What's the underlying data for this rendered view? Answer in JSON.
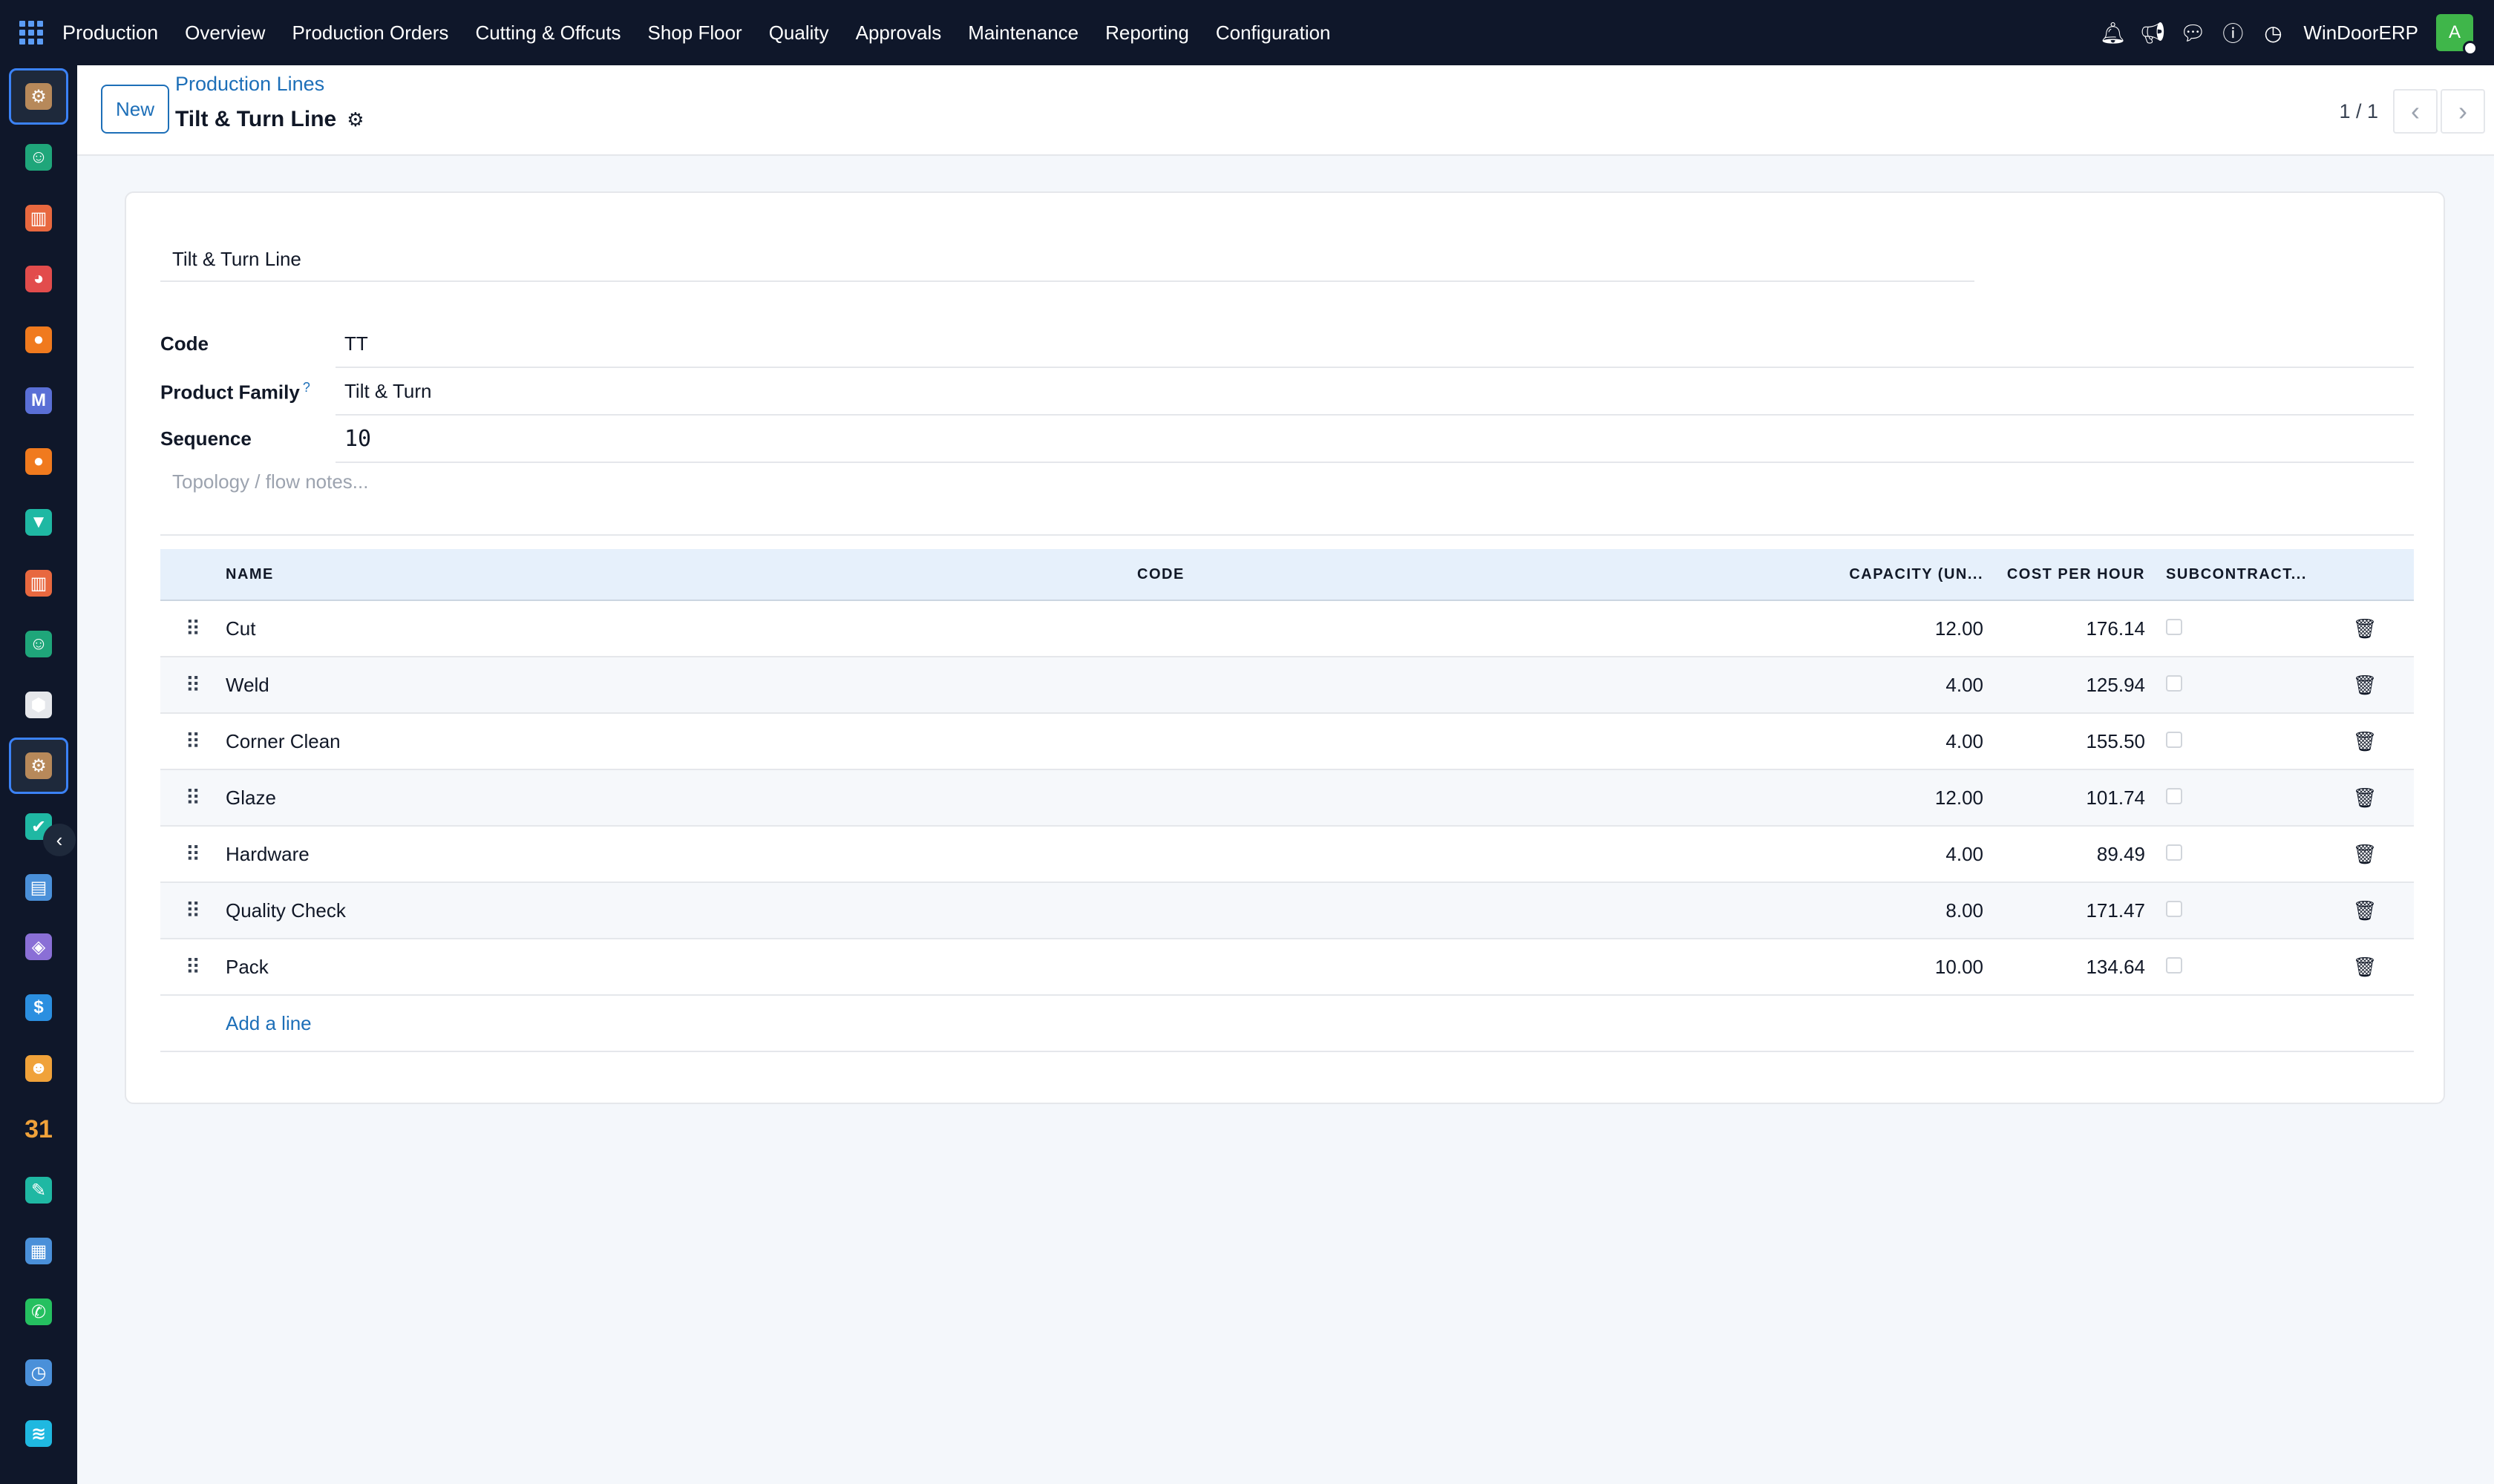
{
  "topbar": {
    "brand": "Production",
    "menu": [
      "Overview",
      "Production Orders",
      "Cutting & Offcuts",
      "Shop Floor",
      "Quality",
      "Approvals",
      "Maintenance",
      "Reporting",
      "Configuration"
    ],
    "company": "WinDoorERP",
    "avatar_letter": "A"
  },
  "control": {
    "new_label": "New",
    "breadcrumb": "Production Lines",
    "record_title": "Tilt & Turn Line",
    "pager": "1 / 1"
  },
  "form": {
    "name": "Tilt & Turn Line",
    "code_label": "Code",
    "code_value": "TT",
    "family_label": "Product Family",
    "family_help": "?",
    "family_value": "Tilt & Turn",
    "sequence_label": "Sequence",
    "sequence_value": "10",
    "notes_placeholder": "Topology / flow notes..."
  },
  "table": {
    "headers": {
      "name": "NAME",
      "code": "CODE",
      "capacity": "CAPACITY (UN...",
      "cost": "COST PER HOUR",
      "subcontract": "SUBCONTRACT..."
    },
    "rows": [
      {
        "name": "Cut",
        "code": "",
        "capacity": "12.00",
        "cost": "176.14"
      },
      {
        "name": "Weld",
        "code": "",
        "capacity": "4.00",
        "cost": "125.94"
      },
      {
        "name": "Corner Clean",
        "code": "",
        "capacity": "4.00",
        "cost": "155.50"
      },
      {
        "name": "Glaze",
        "code": "",
        "capacity": "12.00",
        "cost": "101.74"
      },
      {
        "name": "Hardware",
        "code": "",
        "capacity": "4.00",
        "cost": "89.49"
      },
      {
        "name": "Quality Check",
        "code": "",
        "capacity": "8.00",
        "cost": "171.47"
      },
      {
        "name": "Pack",
        "code": "",
        "capacity": "10.00",
        "cost": "134.64"
      }
    ],
    "add_line": "Add a line"
  },
  "sidebar_apps": [
    {
      "icon": "production-app-icon",
      "color": "#b7895a",
      "glyph": "⚙"
    },
    {
      "icon": "contacts-app-icon",
      "color": "#1fa67a",
      "glyph": "☺"
    },
    {
      "icon": "reporting-app-icon",
      "color": "#e8683f",
      "glyph": "▥"
    },
    {
      "icon": "dashboard-app-icon",
      "color": "#e24c4c",
      "glyph": "◕"
    },
    {
      "icon": "discuss-app-icon",
      "color": "#f07a1e",
      "glyph": "●"
    },
    {
      "icon": "email-app-icon",
      "color": "#5a6fd6",
      "glyph": "M"
    },
    {
      "icon": "chat-app-icon",
      "color": "#f07a1e",
      "glyph": "●"
    },
    {
      "icon": "project-app-icon",
      "color": "#1fb8a3",
      "glyph": "▼"
    },
    {
      "icon": "sales-app-icon",
      "color": "#e8683f",
      "glyph": "▥"
    },
    {
      "icon": "employees-app-icon",
      "color": "#1fa67a",
      "glyph": "☺"
    },
    {
      "icon": "inventory-app-icon",
      "color": "#e5e7eb",
      "glyph": "⬢"
    },
    {
      "icon": "manufacturing-app-icon",
      "color": "#b7895a",
      "glyph": "⚙"
    },
    {
      "icon": "todo-app-icon",
      "color": "#1fb8a3",
      "glyph": "✔"
    },
    {
      "icon": "knowledge-app-icon",
      "color": "#4a90d9",
      "glyph": "▤"
    },
    {
      "icon": "products-app-icon",
      "color": "#8a6fd6",
      "glyph": "◈"
    },
    {
      "icon": "invoicing-app-icon",
      "color": "#2b8fe0",
      "glyph": "$"
    },
    {
      "icon": "team-app-icon",
      "color": "#f0a23a",
      "glyph": "☻"
    },
    {
      "icon": "calendar-app-icon",
      "color": "#f0a23a",
      "glyph": "31"
    },
    {
      "icon": "sign-app-icon",
      "color": "#1fb8a3",
      "glyph": "✎"
    },
    {
      "icon": "apps-dashboard-icon",
      "color": "#4a90d9",
      "glyph": "▦"
    },
    {
      "icon": "whatsapp-app-icon",
      "color": "#25c060",
      "glyph": "✆"
    },
    {
      "icon": "timer-app-icon",
      "color": "#4a90d9",
      "glyph": "◷"
    },
    {
      "icon": "website-app-icon",
      "color": "#1fb8e0",
      "glyph": "≋"
    }
  ]
}
